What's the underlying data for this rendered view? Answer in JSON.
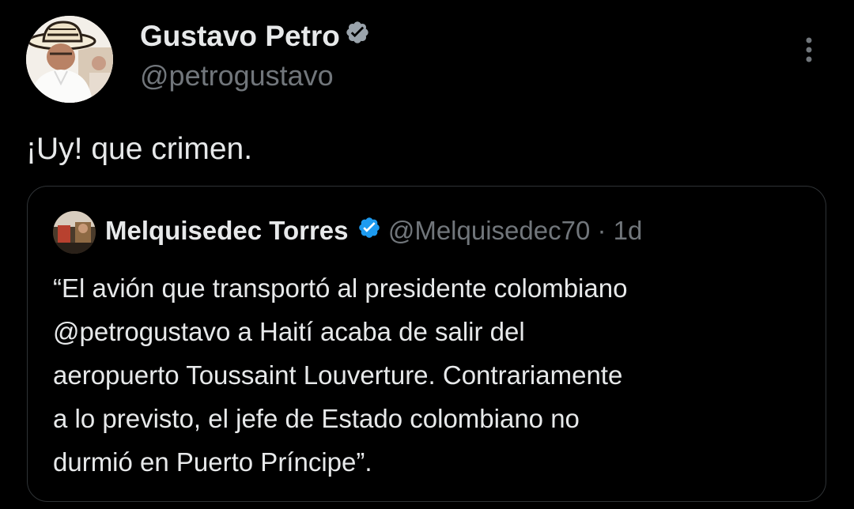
{
  "author": {
    "name": "Gustavo Petro",
    "handle": "@petrogustavo",
    "verified": true
  },
  "tweet": {
    "text": "¡Uy! que crimen."
  },
  "quoted_tweet": {
    "author_name": "Melquisedec Torres",
    "handle": "@Melquisedec70",
    "separator": "·",
    "time": "1d",
    "verified": true,
    "text_lines": [
      "“El avión que transportó al presidente colombiano",
      "@petrogustavo a Haití acaba de salir del",
      "aeropuerto Toussaint Louverture. Contrariamente",
      "a lo previsto, el jefe de Estado colombiano no",
      "durmió en Puerto Príncipe”."
    ]
  },
  "icons": {
    "verified": "verified-badge-icon",
    "more": "more-options-icon"
  },
  "colors": {
    "background": "#000000",
    "text_primary": "#e7e9ea",
    "text_secondary": "#71767b",
    "verified_blue": "#1d9bf0",
    "border": "#2f3336"
  }
}
